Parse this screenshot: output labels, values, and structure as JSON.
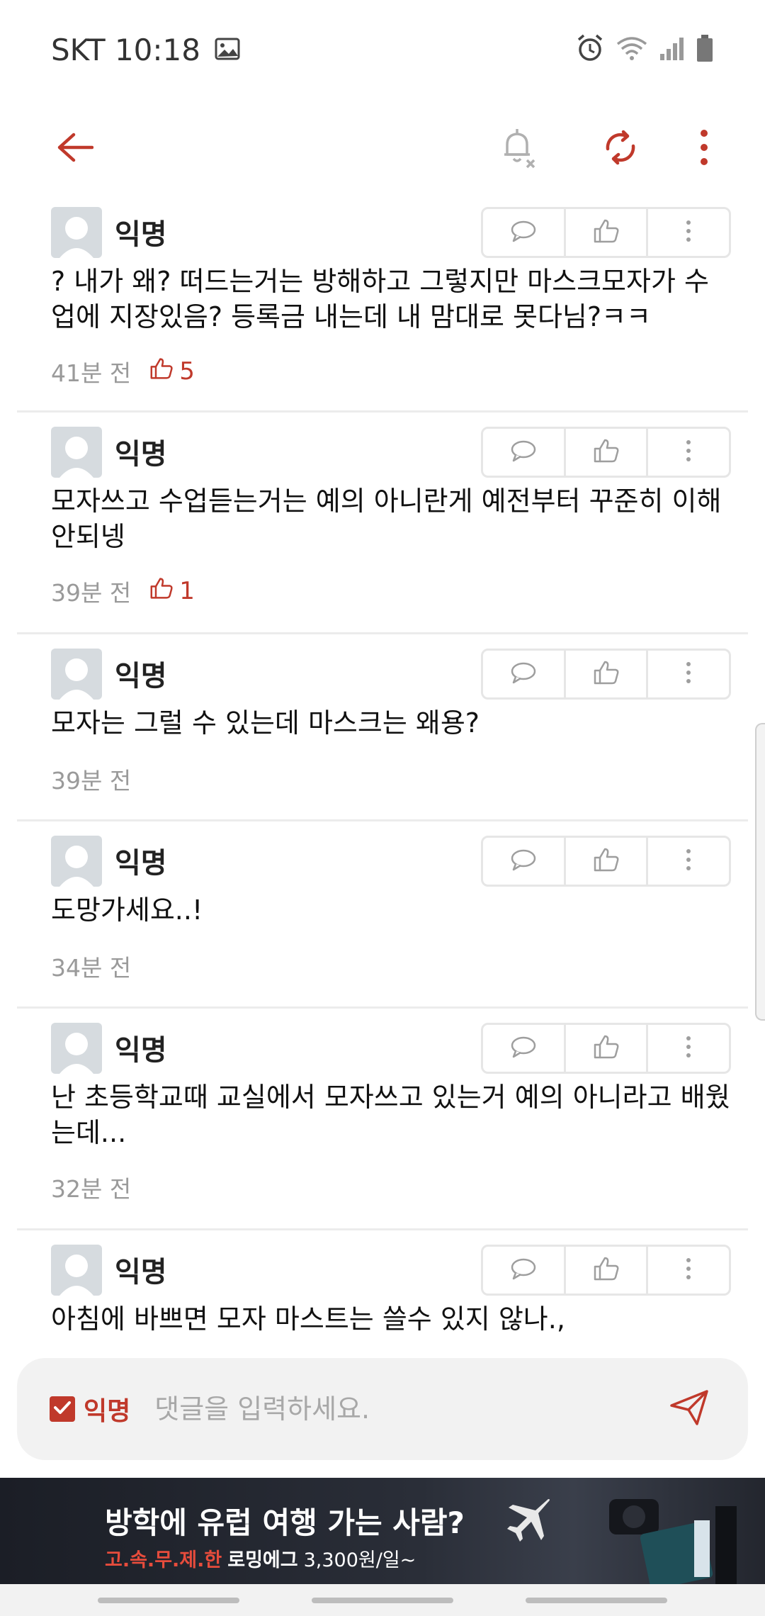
{
  "status_bar": {
    "carrier_time": "SKT 10:18",
    "icons": [
      "image-icon",
      "alarm-icon",
      "wifi-icon",
      "signal-icon",
      "battery-icon"
    ]
  },
  "toolbar": {
    "icons": [
      "back-arrow-icon",
      "notification-off-icon",
      "refresh-icon",
      "more-vertical-icon"
    ],
    "accent_color": "#c0392b"
  },
  "comments": [
    {
      "author": "익명",
      "text": "? 내가 왜? 떠드는거는 방해하고 그렇지만 마스크모자가 수업에 지장있음? 등록금 내는데 내 맘대로 못다님?ㅋㅋ",
      "time": "41분 전",
      "likes": "5"
    },
    {
      "author": "익명",
      "text": "모자쓰고 수업듣는거는 예의 아니란게 예전부터 꾸준히 이해안되넹",
      "time": "39분 전",
      "likes": "1"
    },
    {
      "author": "익명",
      "text": "모자는 그럴 수 있는데 마스크는 왜용?",
      "time": "39분 전",
      "likes": null
    },
    {
      "author": "익명",
      "text": "도망가세요..!",
      "time": "34분 전",
      "likes": null
    },
    {
      "author": "익명",
      "text": "난 초등학교때 교실에서 모자쓰고 있는거 예의 아니라고 배웠는데...",
      "time": "32분 전",
      "likes": null
    },
    {
      "author": "익명",
      "text": "아침에 바쁘면 모자 마스트는 쓸수 있지 않나.,",
      "time": "",
      "likes": null
    }
  ],
  "input_bar": {
    "anonymous_label": "익명",
    "anonymous_checked": true,
    "placeholder": "댓글을 입력하세요."
  },
  "ad": {
    "title": "방학에 유럽 여행 가는 사람?",
    "sub_red": "고.속.무.제.한",
    "sub_bold": "로밍에그",
    "sub_price": "3,300원/일~"
  }
}
